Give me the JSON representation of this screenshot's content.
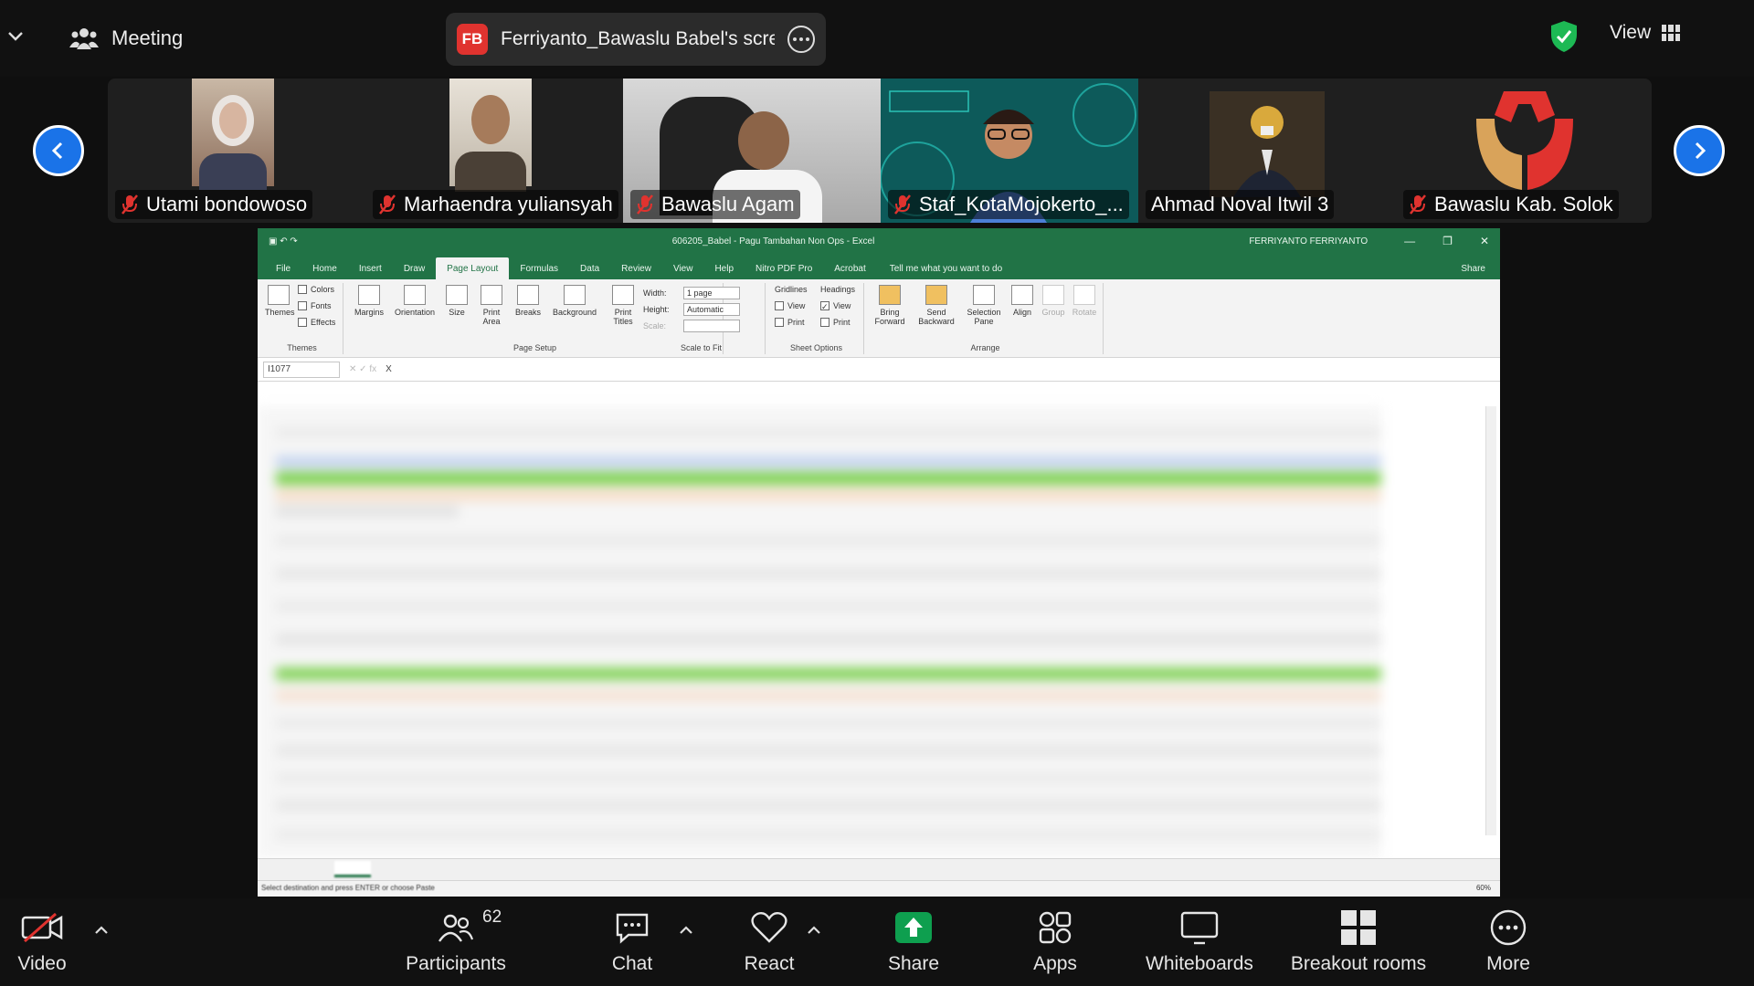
{
  "topbar": {
    "meeting_label": "Meeting",
    "share_badge": "FB",
    "share_title": "Ferriyanto_Bawaslu Babel's scree",
    "view_label": "View",
    "shield_color": "#1db954"
  },
  "participants": [
    {
      "name": "Utami bondowoso",
      "muted": true
    },
    {
      "name": "Marhaendra yuliansyah",
      "muted": true
    },
    {
      "name": "Bawaslu Agam",
      "muted": true
    },
    {
      "name": "Staf_KotaMojokerto_...",
      "muted": true
    },
    {
      "name": "Ahmad Noval Itwil 3",
      "muted": false
    },
    {
      "name": "Bawaslu Kab. Solok",
      "muted": true
    }
  ],
  "excel": {
    "doc_title": "606205_Babel - Pagu Tambahan Non Ops - Excel",
    "user": "FERRIYANTO FERRIYANTO",
    "tabs": [
      "File",
      "Home",
      "Insert",
      "Draw",
      "Page Layout",
      "Formulas",
      "Data",
      "Review",
      "View",
      "Help",
      "Nitro PDF Pro",
      "Acrobat"
    ],
    "active_tab": "Page Layout",
    "tell_me": "Tell me what you want to do",
    "share": "Share",
    "ribbon": {
      "themes_group": "Themes",
      "page_setup_group": "Page Setup",
      "scale_group": "Scale to Fit",
      "sheet_options_group": "Sheet Options",
      "arrange_group": "Arrange",
      "themes": "Themes",
      "colors": "Colors",
      "fonts": "Fonts",
      "effects": "Effects",
      "margins": "Margins",
      "orientation": "Orientation",
      "size": "Size",
      "print_area": "Print Area",
      "breaks": "Breaks",
      "background": "Background",
      "print_titles": "Print Titles",
      "width_label": "Width:",
      "width_value": "1 page",
      "height_label": "Height:",
      "height_value": "Automatic",
      "scale_label": "Scale:",
      "gridlines": "Gridlines",
      "headings": "Headings",
      "view": "View",
      "print": "Print",
      "bring_forward": "Bring Forward",
      "send_backward": "Send Backward",
      "selection_pane": "Selection Pane",
      "align": "Align",
      "group": "Group",
      "rotate": "Rotate"
    },
    "name_box": "I1077",
    "formula_value": "X",
    "status_text": "Select destination and press ENTER or choose Paste",
    "zoom": "60%"
  },
  "toolbar": {
    "video": "Video",
    "participants": "Participants",
    "participants_count": "62",
    "chat": "Chat",
    "react": "React",
    "share": "Share",
    "apps": "Apps",
    "whiteboards": "Whiteboards",
    "breakout": "Breakout rooms",
    "more": "More",
    "share_color": "#0e9f4f",
    "video_off_color": "#e0332f"
  }
}
